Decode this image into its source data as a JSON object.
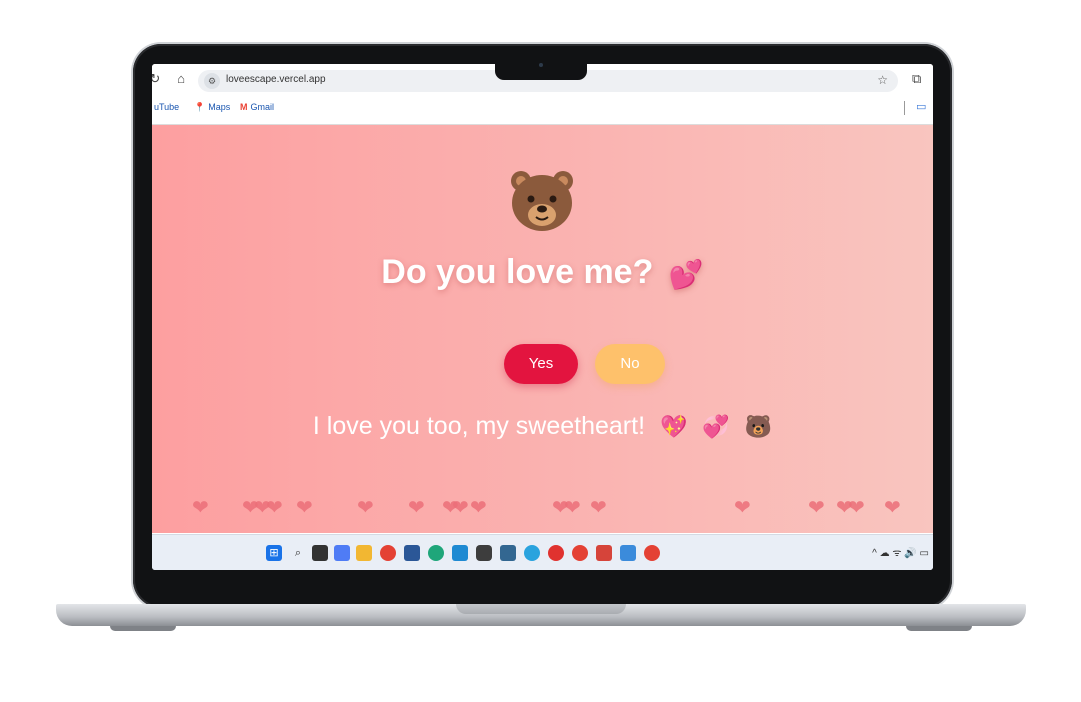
{
  "browser": {
    "url": "loveescape.vercel.app",
    "bookmarks": [
      {
        "label": "uTube",
        "icon": "youtube-icon",
        "color": "#ff0000"
      },
      {
        "label": "Maps",
        "icon": "maps-pin-icon",
        "color": "#34a853"
      },
      {
        "label": "Gmail",
        "icon": "gmail-icon",
        "color": "#ea4335"
      }
    ]
  },
  "page": {
    "bear_emoji": "🐻",
    "question": "Do you love me?",
    "question_emoji": "💕",
    "yes_label": "Yes",
    "no_label": "No",
    "message": "I love you too, my sweetheart!",
    "message_emojis": [
      "💖",
      "💞",
      "🐻"
    ],
    "floating_heart_glyph": "❤",
    "colors": {
      "gradient_start": "#fd9fa0",
      "gradient_end": "#f9c5bf",
      "yes_button": "#e3143f",
      "no_button": "#fec16b",
      "heart": "#ec6f79"
    }
  },
  "taskbar": {
    "icons": [
      "windows-start-icon",
      "search-icon",
      "task-view-icon",
      "copilot-icon",
      "file-explorer-icon",
      "chrome-icon",
      "store-icon",
      "edge-icon",
      "vscode-icon",
      "app-icon",
      "postgres-icon",
      "telegram-icon",
      "wps-icon",
      "chrome-icon",
      "snipping-icon",
      "photos-icon",
      "chrome-icon"
    ]
  }
}
